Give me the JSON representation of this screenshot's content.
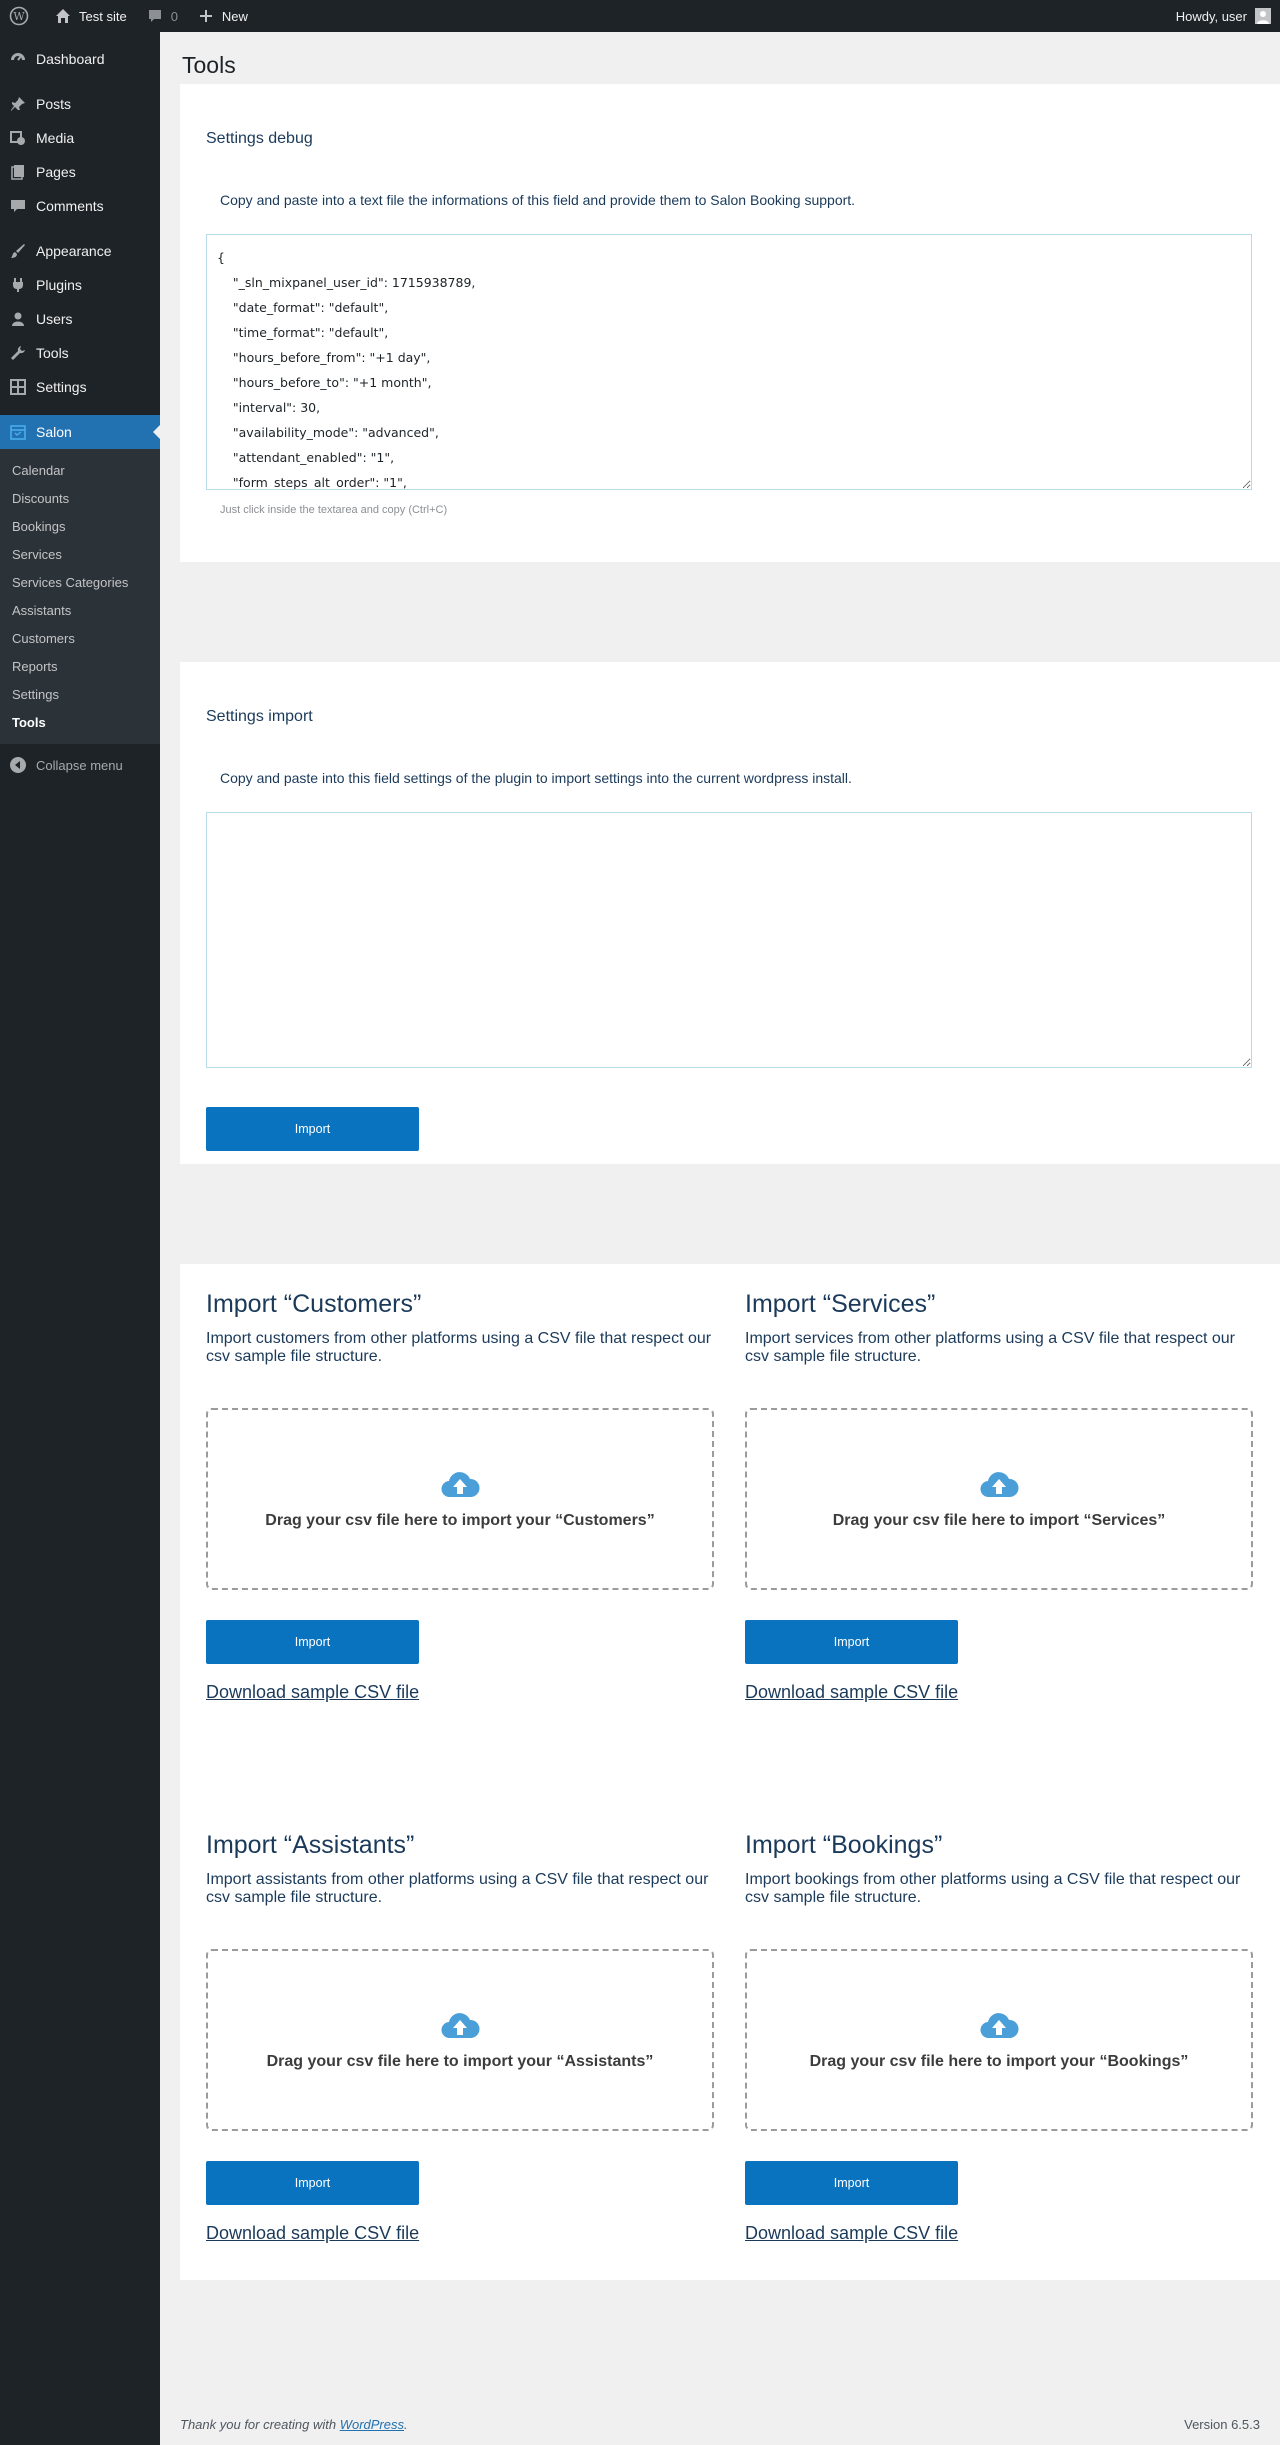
{
  "adminbar": {
    "site_name": "Test site",
    "comments_count": "0",
    "new_label": "New",
    "howdy": "Howdy, user"
  },
  "sidebar": {
    "items": [
      {
        "label": "Dashboard",
        "icon": "dashboard-icon"
      },
      {
        "label": "Posts",
        "icon": "pin-icon"
      },
      {
        "label": "Media",
        "icon": "media-icon"
      },
      {
        "label": "Pages",
        "icon": "page-icon"
      },
      {
        "label": "Comments",
        "icon": "comment-icon"
      },
      {
        "label": "Appearance",
        "icon": "brush-icon"
      },
      {
        "label": "Plugins",
        "icon": "plugin-icon"
      },
      {
        "label": "Users",
        "icon": "user-icon"
      },
      {
        "label": "Tools",
        "icon": "wrench-icon"
      },
      {
        "label": "Settings",
        "icon": "settings-icon"
      },
      {
        "label": "Salon",
        "icon": "calendar-icon"
      }
    ],
    "submenu": [
      "Calendar",
      "Discounts",
      "Bookings",
      "Services",
      "Services Categories",
      "Assistants",
      "Customers",
      "Reports",
      "Settings",
      "Tools"
    ],
    "collapse_label": "Collapse menu"
  },
  "page_title": "Tools",
  "debug": {
    "title": "Settings debug",
    "description": "Copy and paste into a text file the informations of this field and provide them to Salon Booking support.",
    "textarea_value": "{\n    \"_sln_mixpanel_user_id\": 1715938789,\n    \"date_format\": \"default\",\n    \"time_format\": \"default\",\n    \"hours_before_from\": \"+1 day\",\n    \"hours_before_to\": \"+1 month\",\n    \"interval\": 30,\n    \"availability_mode\": \"advanced\",\n    \"attendant_enabled\": \"1\",\n    \"form_steps_alt_order\": \"1\",",
    "hint": "Just click inside the textarea and copy (Ctrl+C)"
  },
  "import_settings": {
    "title": "Settings import",
    "description": "Copy and paste into this field settings of the plugin to import settings into the current wordpress install.",
    "textarea_value": "",
    "button_label": "Import"
  },
  "csv_imports": [
    {
      "title": "Import “Customers”",
      "description": "Import customers from other platforms using a CSV file that respect our csv sample file structure.",
      "drop_text": "Drag your csv file here to import your “Customers”",
      "button_label": "Import",
      "link_label": "Download sample CSV file"
    },
    {
      "title": "Import “Services”",
      "description": "Import services from other platforms using a CSV file that respect our csv sample file structure.",
      "drop_text": "Drag your csv file here to import “Services”",
      "button_label": "Import",
      "link_label": "Download sample CSV file"
    },
    {
      "title": "Import “Assistants”",
      "description": "Import assistants from other platforms using a CSV file that respect our csv sample file structure.",
      "drop_text": "Drag your csv file here to import your “Assistants”",
      "button_label": "Import",
      "link_label": "Download sample CSV file"
    },
    {
      "title": "Import “Bookings”",
      "description": "Import bookings from other platforms using a CSV file that respect our csv sample file structure.",
      "drop_text": "Drag your csv file here to import your “Bookings”",
      "button_label": "Import",
      "link_label": "Download sample CSV file"
    }
  ],
  "footer": {
    "thanks_prefix": "Thank you for creating with ",
    "thanks_link": "WordPress",
    "thanks_suffix": ".",
    "version": "Version 6.5.3"
  },
  "colors": {
    "accent": "#2271b1",
    "button": "#0a73bf",
    "heading": "#1b3a5a",
    "cloud": "#4a9fd8"
  }
}
